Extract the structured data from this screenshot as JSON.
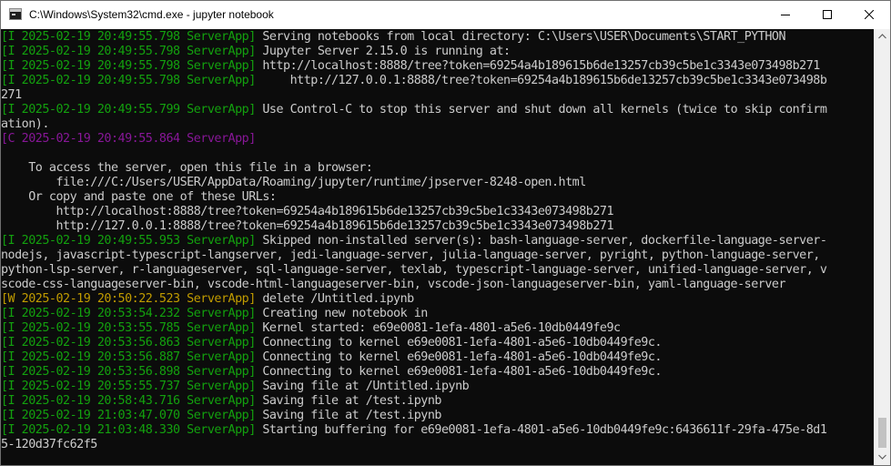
{
  "window": {
    "title": "C:\\Windows\\System32\\cmd.exe - jupyter  notebook"
  },
  "colors": {
    "console_bg": "#0c0c0c",
    "console_text": "#cccccc",
    "info_prefix": "#13a10e",
    "warn_prefix": "#c19c00",
    "critical_prefix": "#881798"
  },
  "console": {
    "lines": [
      {
        "level": "I",
        "prefix": "[I 2025-02-19 20:49:55.798 ServerApp]",
        "text": " Serving notebooks from local directory: C:\\Users\\USER\\Documents\\START_PYTHON"
      },
      {
        "level": "I",
        "prefix": "[I 2025-02-19 20:49:55.798 ServerApp]",
        "text": " Jupyter Server 2.15.0 is running at:"
      },
      {
        "level": "I",
        "prefix": "[I 2025-02-19 20:49:55.798 ServerApp]",
        "text": " http://localhost:8888/tree?token=69254a4b189615b6de13257cb39c5be1c3343e073498b271"
      },
      {
        "level": "I",
        "prefix": "[I 2025-02-19 20:49:55.798 ServerApp]",
        "text": "     http://127.0.0.1:8888/tree?token=69254a4b189615b6de13257cb39c5be1c3343e073498b"
      },
      {
        "level": "",
        "prefix": "",
        "text": "271"
      },
      {
        "level": "I",
        "prefix": "[I 2025-02-19 20:49:55.799 ServerApp]",
        "text": " Use Control-C to stop this server and shut down all kernels (twice to skip confirm"
      },
      {
        "level": "",
        "prefix": "",
        "text": "ation)."
      },
      {
        "level": "C",
        "prefix": "[C 2025-02-19 20:49:55.864 ServerApp]",
        "text": ""
      },
      {
        "level": "",
        "prefix": "",
        "text": ""
      },
      {
        "level": "",
        "prefix": "",
        "text": "    To access the server, open this file in a browser:"
      },
      {
        "level": "",
        "prefix": "",
        "text": "        file:///C:/Users/USER/AppData/Roaming/jupyter/runtime/jpserver-8248-open.html"
      },
      {
        "level": "",
        "prefix": "",
        "text": "    Or copy and paste one of these URLs:"
      },
      {
        "level": "",
        "prefix": "",
        "text": "        http://localhost:8888/tree?token=69254a4b189615b6de13257cb39c5be1c3343e073498b271"
      },
      {
        "level": "",
        "prefix": "",
        "text": "        http://127.0.0.1:8888/tree?token=69254a4b189615b6de13257cb39c5be1c3343e073498b271"
      },
      {
        "level": "I",
        "prefix": "[I 2025-02-19 20:49:55.953 ServerApp]",
        "text": " Skipped non-installed server(s): bash-language-server, dockerfile-language-server-"
      },
      {
        "level": "",
        "prefix": "",
        "text": "nodejs, javascript-typescript-langserver, jedi-language-server, julia-language-server, pyright, python-language-server,"
      },
      {
        "level": "",
        "prefix": "",
        "text": "python-lsp-server, r-languageserver, sql-language-server, texlab, typescript-language-server, unified-language-server, v"
      },
      {
        "level": "",
        "prefix": "",
        "text": "scode-css-languageserver-bin, vscode-html-languageserver-bin, vscode-json-languageserver-bin, yaml-language-server"
      },
      {
        "level": "W",
        "prefix": "[W 2025-02-19 20:50:22.523 ServerApp]",
        "text": " delete /Untitled.ipynb"
      },
      {
        "level": "I",
        "prefix": "[I 2025-02-19 20:53:54.232 ServerApp]",
        "text": " Creating new notebook in"
      },
      {
        "level": "I",
        "prefix": "[I 2025-02-19 20:53:55.785 ServerApp]",
        "text": " Kernel started: e69e0081-1efa-4801-a5e6-10db0449fe9c"
      },
      {
        "level": "I",
        "prefix": "[I 2025-02-19 20:53:56.863 ServerApp]",
        "text": " Connecting to kernel e69e0081-1efa-4801-a5e6-10db0449fe9c."
      },
      {
        "level": "I",
        "prefix": "[I 2025-02-19 20:53:56.887 ServerApp]",
        "text": " Connecting to kernel e69e0081-1efa-4801-a5e6-10db0449fe9c."
      },
      {
        "level": "I",
        "prefix": "[I 2025-02-19 20:53:56.898 ServerApp]",
        "text": " Connecting to kernel e69e0081-1efa-4801-a5e6-10db0449fe9c."
      },
      {
        "level": "I",
        "prefix": "[I 2025-02-19 20:55:55.737 ServerApp]",
        "text": " Saving file at /Untitled.ipynb"
      },
      {
        "level": "I",
        "prefix": "[I 2025-02-19 20:58:43.716 ServerApp]",
        "text": " Saving file at /test.ipynb"
      },
      {
        "level": "I",
        "prefix": "[I 2025-02-19 21:03:47.070 ServerApp]",
        "text": " Saving file at /test.ipynb"
      },
      {
        "level": "I",
        "prefix": "[I 2025-02-19 21:03:48.330 ServerApp]",
        "text": " Starting buffering for e69e0081-1efa-4801-a5e6-10db0449fe9c:6436611f-29fa-475e-8d1"
      },
      {
        "level": "",
        "prefix": "",
        "text": "5-120d37fc62f5"
      }
    ]
  },
  "icons": {
    "app": "cmd-app-icon",
    "minimize": "minimize-icon",
    "maximize": "maximize-icon",
    "close": "close-icon",
    "scroll_up": "scroll-up-arrow-icon",
    "scroll_down": "scroll-down-arrow-icon"
  }
}
